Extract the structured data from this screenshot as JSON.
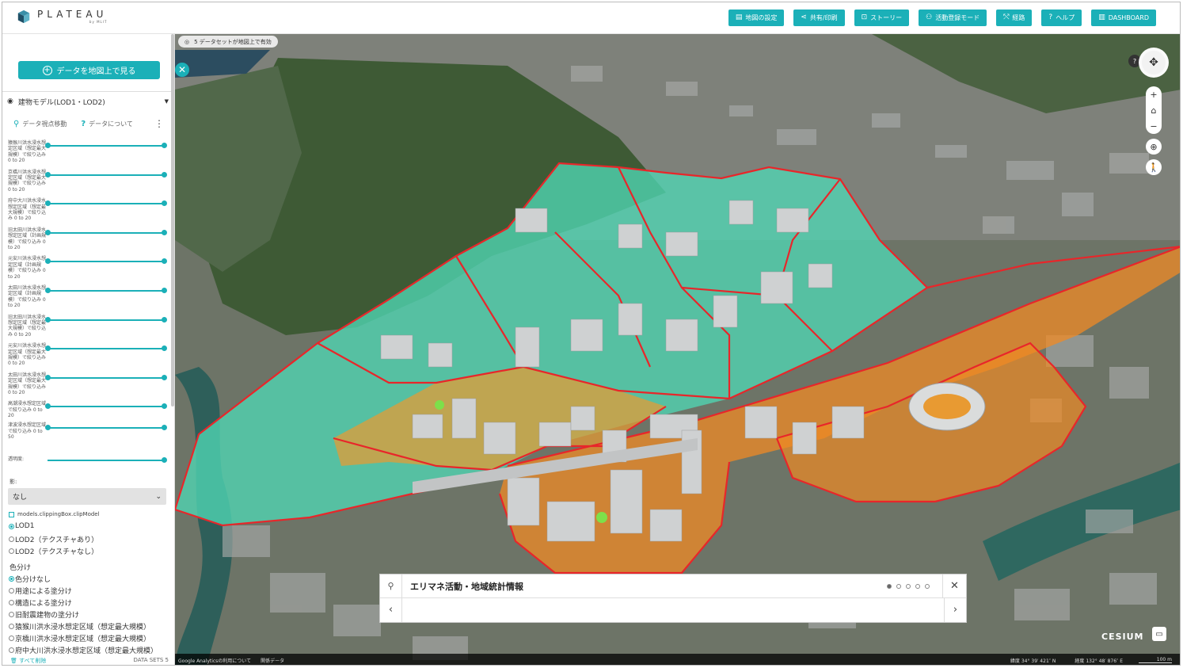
{
  "app": {
    "logo": "PLATEAU",
    "logo_sub": "by MLIT"
  },
  "topnav": [
    {
      "label": "地図の設定",
      "icon": "layers-icon"
    },
    {
      "label": "共有/印刷",
      "icon": "share-icon"
    },
    {
      "label": "ストーリー",
      "icon": "story-icon"
    },
    {
      "label": "活動登録モード",
      "icon": "people-icon"
    },
    {
      "label": "経路",
      "icon": "route-icon"
    },
    {
      "label": "ヘルプ",
      "icon": "help-icon"
    },
    {
      "label": "DASHBOARD",
      "icon": "book-icon"
    }
  ],
  "sidebar": {
    "view_button": "データを地図上で見る",
    "layer_title": "建物モデル(LOD1・LOD2)",
    "action_move": "データ視点移動",
    "action_about": "データについて",
    "filters": [
      "猿猴川洪水浸水想定区域（想定最大規模）で絞り込み 0 to 20",
      "京橋川洪水浸水想定区域（想定最大規模）で絞り込み 0 to 20",
      "府中大川洪水浸水想定区域（想定最大規模）で絞り込み 0 to 20",
      "旧太田川洪水浸水想定区域（計画規模）で絞り込み 0 to 20",
      "元安川洪水浸水想定区域（計画規模）で絞り込み 0 to 20",
      "太田川洪水浸水想定区域（計画規模）で絞り込み 0 to 20",
      "旧太田川洪水浸水想定区域（想定最大規模）で絞り込み 0 to 20",
      "元安川洪水浸水想定区域（想定最大規模）で絞り込み 0 to 20",
      "太田川洪水浸水想定区域（想定最大規模）で絞り込み 0 to 20",
      "高潮浸水想定区域で絞り込み 0 to 20",
      "津波浸水想定区域で絞り込み 0 to 50"
    ],
    "opacity_label": "透明度:",
    "shadow_label": "影:",
    "shadow_value": "なし",
    "clip_label": "models.clippingBox.clipModel",
    "lod_options": [
      "LOD1",
      "LOD2（テクスチャあり）",
      "LOD2（テクスチャなし）"
    ],
    "lod_selected": 0,
    "color_label": "色分け",
    "color_options": [
      "色分けなし",
      "用途による塗分け",
      "構造による塗分け",
      "旧耐震建物の塗分け",
      "猿猴川洪水浸水想定区域（想定最大規模）",
      "京橋川洪水浸水想定区域（想定最大規模）",
      "府中大川洪水浸水想定区域（想定最大規模）"
    ],
    "color_selected": 0,
    "delete_all": "すべて削除",
    "datasets": "DATA SETS 5"
  },
  "map": {
    "badge": "5 データセットが地図上で有効",
    "story_title": "エリマネ活動・地域統計情報",
    "story_pages": 5,
    "story_current": 0,
    "attribution_1": "Google Analyticsの利用について",
    "attribution_2": "関係データ",
    "lat_label": "緯度",
    "lat_value": "34° 39′ 421″ N",
    "lon_label": "経度",
    "lon_value": "132° 48′ 876″ E",
    "scale": "100 m",
    "cesium": "CESIUM",
    "colors": {
      "accent": "#1bb0b8",
      "teal_zone": "#4fd6b4",
      "orange_zone": "#f08a24",
      "boundary": "#e8262a"
    }
  }
}
